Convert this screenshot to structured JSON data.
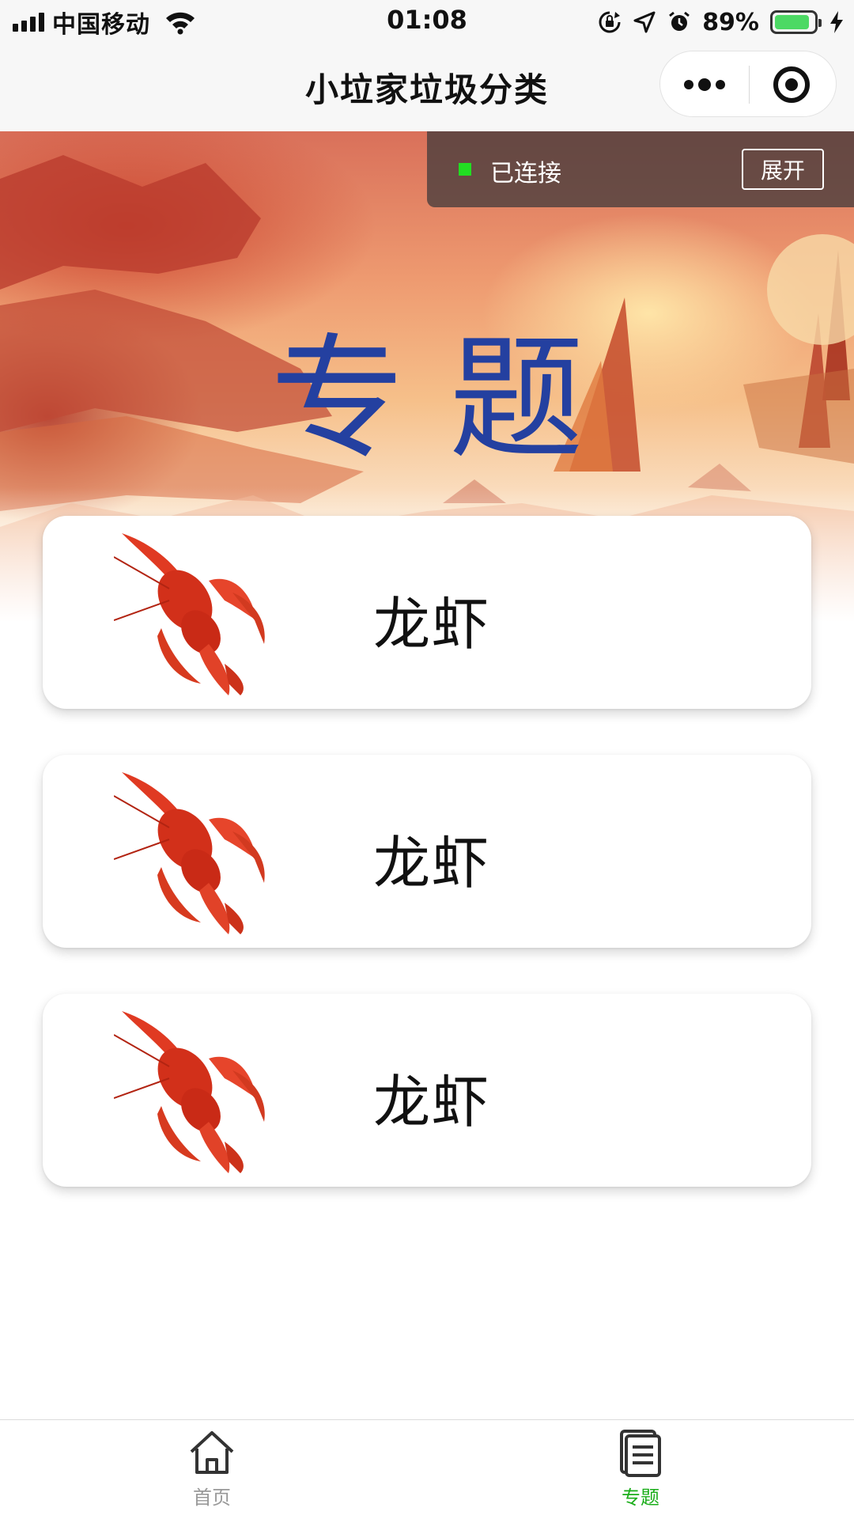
{
  "status_bar": {
    "carrier": "中国移动",
    "time": "01:08",
    "battery_percent": "89%",
    "battery_level": 0.89,
    "icons": [
      "signal-icon",
      "wifi-icon",
      "orientation-lock-icon",
      "location-icon",
      "alarm-icon",
      "battery-icon",
      "charging-icon"
    ]
  },
  "nav": {
    "title": "小垃家垃圾分类",
    "capsule_icons": [
      "more-icon",
      "close-miniprogram-icon"
    ]
  },
  "debug_bar": {
    "status": "已连接",
    "button_label": "展开",
    "dot_color": "#22dd22"
  },
  "hero": {
    "title": "专题"
  },
  "topics": [
    {
      "label": "龙虾",
      "icon": "lobster-image"
    },
    {
      "label": "龙虾",
      "icon": "lobster-image"
    },
    {
      "label": "龙虾",
      "icon": "lobster-image"
    }
  ],
  "tab_bar": {
    "tabs": [
      {
        "label": "首页",
        "icon": "home-icon",
        "active": false
      },
      {
        "label": "专题",
        "icon": "topics-icon",
        "active": true
      }
    ],
    "active_color": "#1aad19",
    "inactive_color": "#999999"
  },
  "colors": {
    "hero_title": "#2440a0",
    "bar_background": "#f7f7f7"
  }
}
